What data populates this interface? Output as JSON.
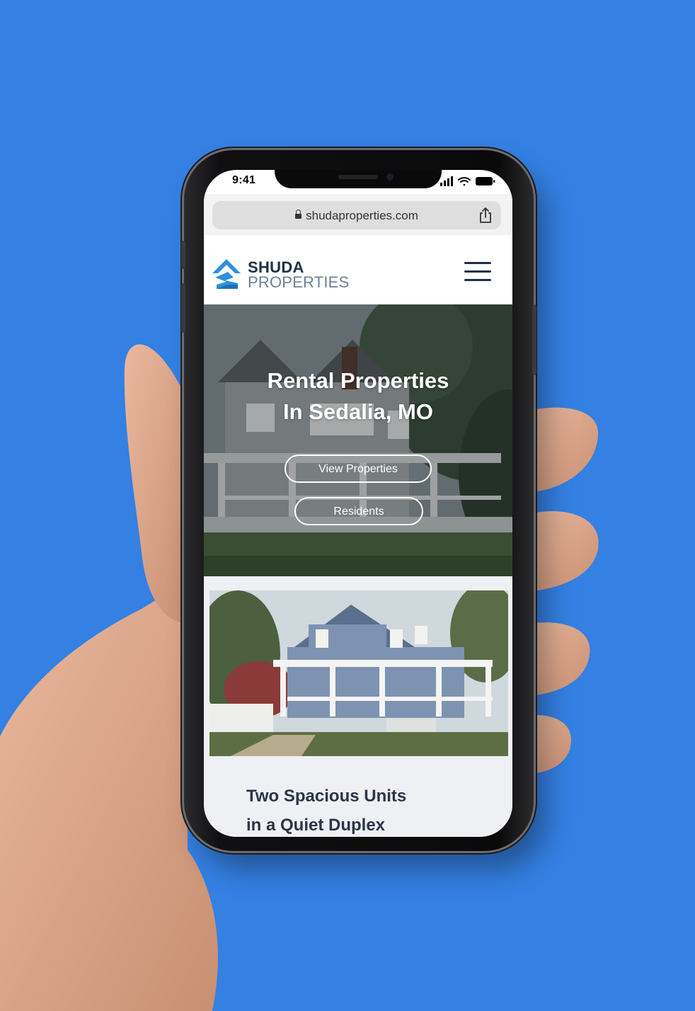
{
  "status_bar": {
    "time": "9:41"
  },
  "browser": {
    "url": "shudaproperties.com"
  },
  "site": {
    "logo_line1": "SHUDA",
    "logo_line2": "PROPERTIES"
  },
  "hero": {
    "title_line1": "Rental Properties",
    "title_line2": "In Sedalia, MO",
    "primary_button": "View Properties",
    "secondary_button": "Residents"
  },
  "feature": {
    "title_line1": "Two Spacious Units",
    "title_line2": "in a Quiet Duplex"
  },
  "colors": {
    "background": "#3480e3",
    "logo_dark": "#1f2f46",
    "logo_blue": "#2e8fde",
    "logo_grey": "#6e8196"
  }
}
